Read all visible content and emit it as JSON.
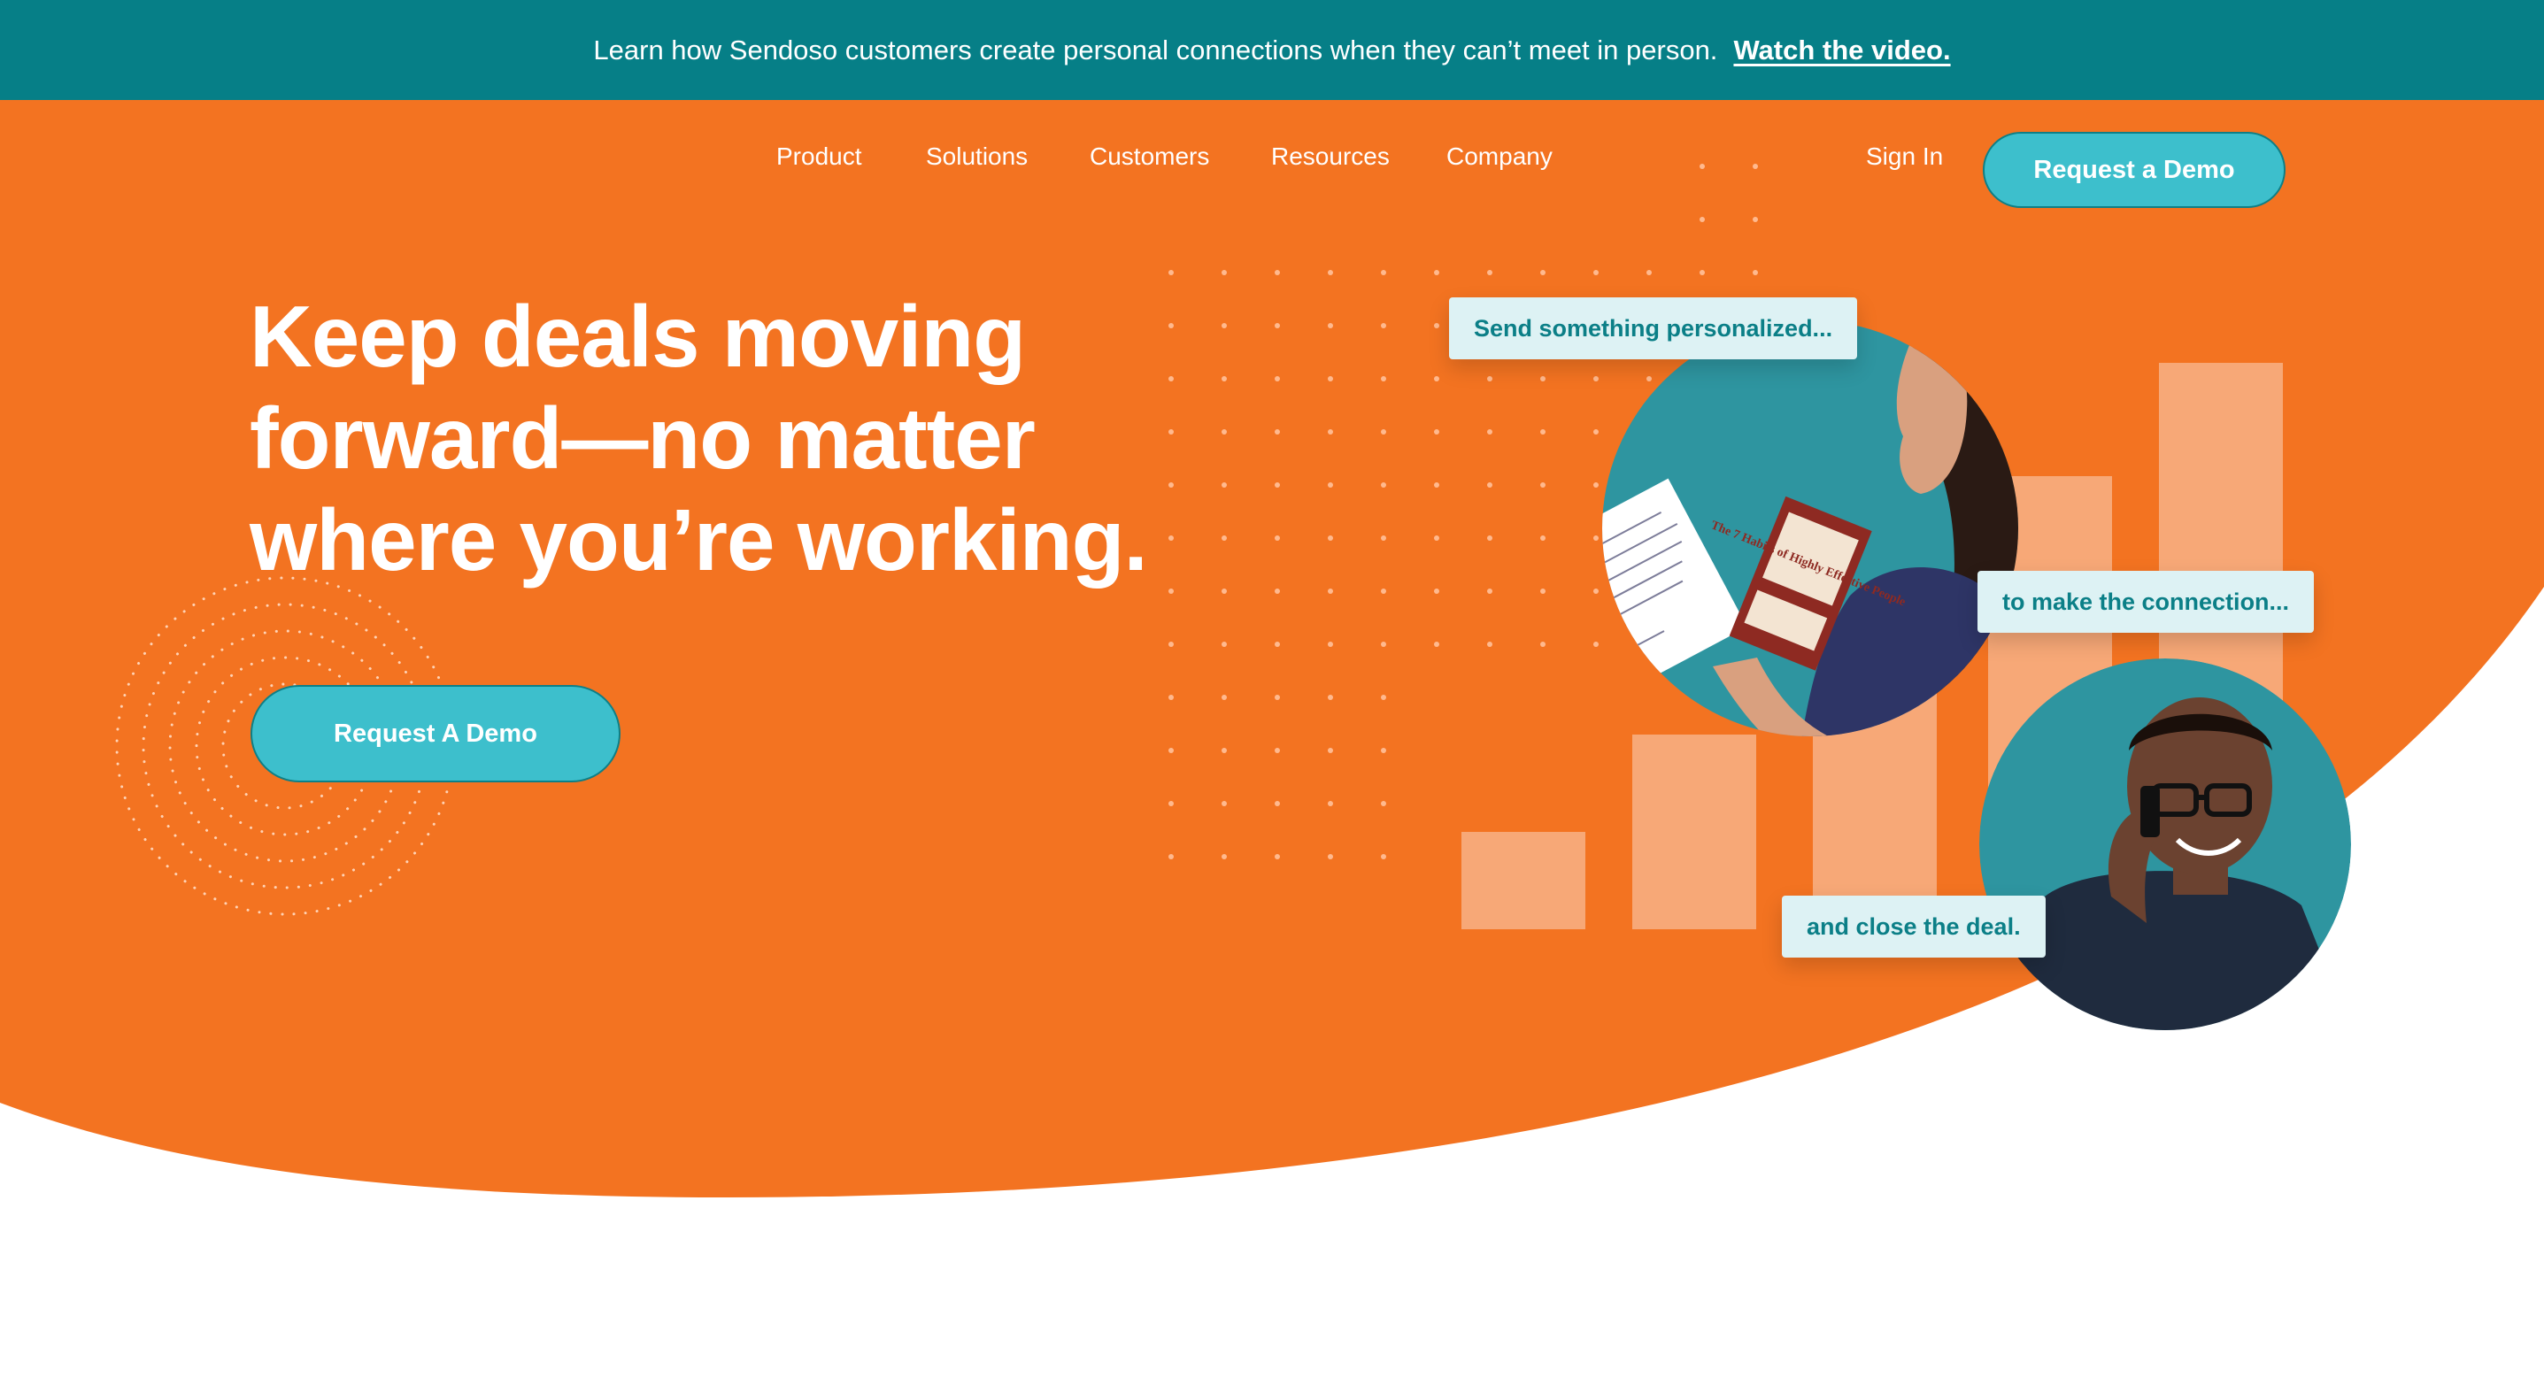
{
  "announcement": {
    "message": "Learn how Sendoso customers create personal connections when they can’t meet in person.",
    "link_label": "Watch the video."
  },
  "nav": {
    "items": [
      {
        "label": "Product"
      },
      {
        "label": "Solutions"
      },
      {
        "label": "Customers"
      },
      {
        "label": "Resources"
      },
      {
        "label": "Company"
      }
    ],
    "sign_in": "Sign In",
    "cta": "Request a Demo"
  },
  "hero": {
    "headline_lines": [
      "Keep deals moving",
      "forward—no matter",
      "where you’re working."
    ],
    "cta": "Request A Demo"
  },
  "illustration": {
    "captions": [
      "Send something personalized...",
      "to make the connection...",
      "and close the deal."
    ],
    "card_text": "The 7 Habits of Highly Effective People"
  },
  "colors": {
    "announcement_bg": "#067F87",
    "hero_orange": "#F37321",
    "accent_teal": "#3DBFCC",
    "bar_peach": "#F7A877",
    "photo_teal": "#2E95A0",
    "caption_bg": "#DDF2F4",
    "caption_text": "#0B7F87"
  }
}
